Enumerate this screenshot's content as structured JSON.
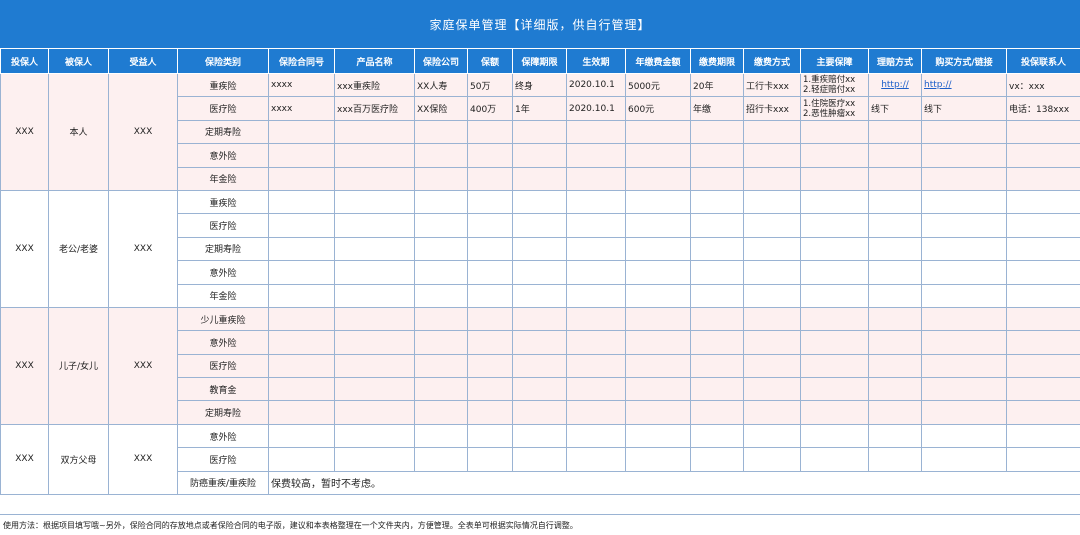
{
  "title": "家庭保单管理【详细版，供自行管理】",
  "headers": [
    "投保人",
    "被保人",
    "受益人",
    "保险类别",
    "保险合同号",
    "产品名称",
    "保险公司",
    "保额",
    "保障期限",
    "生效期",
    "年缴费金额",
    "缴费期限",
    "缴费方式",
    "主要保障",
    "理赔方式",
    "购买方式/链接",
    "投保联系人"
  ],
  "groups": [
    {
      "policyholder": "XXX",
      "insured": "本人",
      "beneficiary": "XXX",
      "rows": [
        {
          "category": "重疾险",
          "contract": "xxxx",
          "product": "xxx重疾险",
          "company": "XX人寿",
          "amount": "50万",
          "term": "终身",
          "effective": "2020.10.1",
          "premium": "5000元",
          "pay_period": "20年",
          "pay_method": "工行卡xxx",
          "coverage_1": "1.重疾赔付xx",
          "coverage_2": "2.轻症赔付xx",
          "claim": "http://",
          "purchase": "http://",
          "contact": "vx：xxx"
        },
        {
          "category": "医疗险",
          "contract": "xxxx",
          "product": "xxx百万医疗险",
          "company": "XX保险",
          "amount": "400万",
          "term": "1年",
          "effective": "2020.10.1",
          "premium": "600元",
          "pay_period": "年缴",
          "pay_method": "招行卡xxx",
          "coverage_1": "1.住院医疗xx",
          "coverage_2": "2.恶性肿瘤xx",
          "claim": "线下",
          "purchase": "线下",
          "contact": "电话：138xxx"
        },
        {
          "category": "定期寿险"
        },
        {
          "category": "意外险"
        },
        {
          "category": "年金险"
        }
      ]
    },
    {
      "policyholder": "XXX",
      "insured": "老公/老婆",
      "beneficiary": "XXX",
      "rows": [
        {
          "category": "重疾险"
        },
        {
          "category": "医疗险"
        },
        {
          "category": "定期寿险"
        },
        {
          "category": "意外险"
        },
        {
          "category": "年金险"
        }
      ]
    },
    {
      "policyholder": "XXX",
      "insured": "儿子/女儿",
      "beneficiary": "XXX",
      "rows": [
        {
          "category": "少儿重疾险"
        },
        {
          "category": "意外险"
        },
        {
          "category": "医疗险"
        },
        {
          "category": "教育金"
        },
        {
          "category": "定期寿险"
        }
      ]
    },
    {
      "policyholder": "XXX",
      "insured": "双方父母",
      "beneficiary": "XXX",
      "rows": [
        {
          "category": "意外险"
        },
        {
          "category": "医疗险"
        },
        {
          "category": "防癌重疾/重疾险",
          "note": "保费较高，暂时不考虑。"
        }
      ]
    }
  ],
  "footer": "使用方法：根据项目填写哦~另外，保险合同的存放地点或者保险合同的电子版，建议和本表格整理在一个文件夹内，方便管理。全表单可根据实际情况自行调整。",
  "colors": {
    "header_bg": "#1f7bd1",
    "pink_row": "#fdf0f0",
    "link": "#1d5fc9"
  }
}
